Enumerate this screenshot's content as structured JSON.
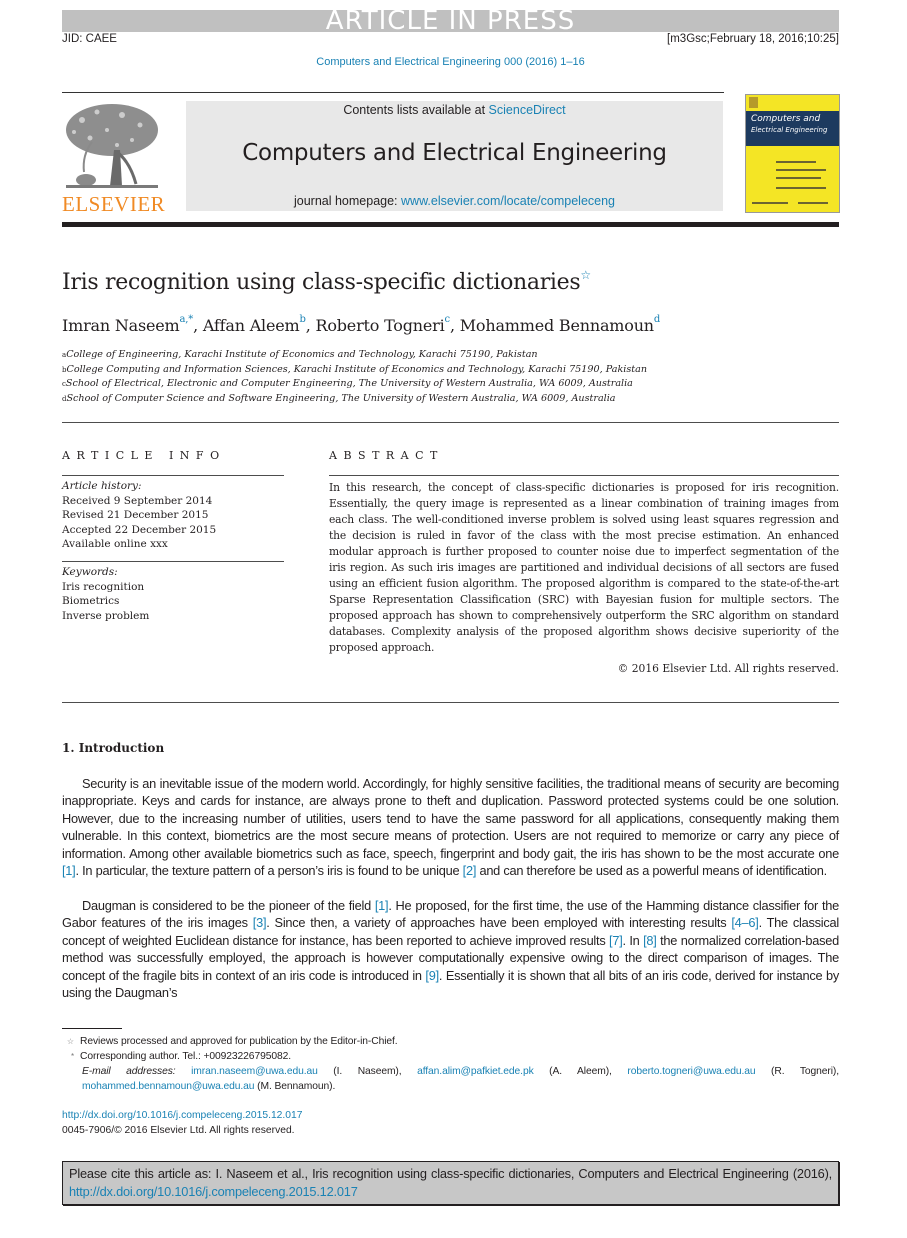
{
  "banner": {
    "press_label": "ARTICLE IN PRESS",
    "jid": "JID: CAEE",
    "stamp": "[m3Gsc;February 18, 2016;10:25]",
    "journal_ref": "Computers and Electrical Engineering 000 (2016) 1–16"
  },
  "header": {
    "publisher_logo_text": "ELSEVIER",
    "contents_prefix": "Contents lists available at ",
    "contents_link": "ScienceDirect",
    "journal_title": "Computers and Electrical Engineering",
    "homepage_prefix": "journal homepage: ",
    "homepage_link": "www.elsevier.com/locate/compeleceng",
    "cover_title_line1": "Computers and",
    "cover_title_line2": "Electrical Engineering"
  },
  "article": {
    "title": "Iris recognition using class-specific dictionaries",
    "title_mark": "☆",
    "authors": [
      {
        "name": "Imran Naseem",
        "sup": "a,*",
        "sep": ", "
      },
      {
        "name": "Affan Aleem",
        "sup": "b",
        "sep": ", "
      },
      {
        "name": "Roberto Togneri",
        "sup": "c",
        "sep": ", "
      },
      {
        "name": "Mohammed Bennamoun",
        "sup": "d",
        "sep": ""
      }
    ],
    "affiliations": [
      {
        "key": "a",
        "text": "College of Engineering, Karachi Institute of Economics and Technology, Karachi 75190, Pakistan"
      },
      {
        "key": "b",
        "text": "College Computing and Information Sciences, Karachi Institute of Economics and Technology, Karachi 75190, Pakistan"
      },
      {
        "key": "c",
        "text": "School of Electrical, Electronic and Computer Engineering, The University of Western Australia, WA 6009, Australia"
      },
      {
        "key": "d",
        "text": "School of Computer Science and Software Engineering, The University of Western Australia, WA 6009, Australia"
      }
    ]
  },
  "article_info": {
    "heading": "ARTICLE INFO",
    "history_label": "Article history:",
    "history": [
      "Received 9 September 2014",
      "Revised 21 December 2015",
      "Accepted 22 December 2015",
      "Available online xxx"
    ],
    "keywords_label": "Keywords:",
    "keywords": [
      "Iris recognition",
      "Biometrics",
      "Inverse problem"
    ]
  },
  "abstract": {
    "heading": "ABSTRACT",
    "text": "In this research, the concept of class-specific dictionaries is proposed for iris recognition. Essentially, the query image is represented as a linear combination of training images from each class. The well-conditioned inverse problem is solved using least squares regression and the decision is ruled in favor of the class with the most precise estimation. An enhanced modular approach is further proposed to counter noise due to imperfect segmentation of the iris region. As such iris images are partitioned and individual decisions of all sectors are fused using an efficient fusion algorithm. The proposed algorithm is compared to the state-of-the-art Sparse Representation Classification (SRC) with Bayesian fusion for multiple sectors. The proposed approach has shown to comprehensively outperform the SRC algorithm on standard databases. Complexity analysis of the proposed algorithm shows decisive superiority of the proposed approach.",
    "copyright": "© 2016 Elsevier Ltd. All rights reserved."
  },
  "introduction": {
    "heading": "1.  Introduction",
    "para1": [
      {
        "t": "Security is an inevitable issue of the modern world. Accordingly, for highly sensitive facilities, the traditional means of security are becoming inappropriate. Keys and cards for instance, are always prone to theft and duplication. Password protected systems could be one solution. However, due to the increasing number of utilities, users tend to have the same password for all applications, consequently making them vulnerable. In this context, biometrics are the most secure means of protection. Users are not required to memorize or carry any piece of information. Among other available biometrics such as face, speech, fingerprint and body gait, the iris has shown to be the most accurate one "
      },
      {
        "ref": "[1]"
      },
      {
        "t": ". In particular, the texture pattern of a person’s iris is found to be unique "
      },
      {
        "ref": "[2]"
      },
      {
        "t": " and can therefore be used as a powerful means of identification."
      }
    ],
    "para2": [
      {
        "t": "Daugman is considered to be the pioneer of the field "
      },
      {
        "ref": "[1]"
      },
      {
        "t": ". He proposed, for the first time, the use of the Hamming distance classifier for the Gabor features of the iris images "
      },
      {
        "ref": "[3]"
      },
      {
        "t": ". Since then, a variety of approaches have been employed with interesting results "
      },
      {
        "ref": "[4–6]"
      },
      {
        "t": ". The classical concept of weighted Euclidean distance for instance, has been reported to achieve improved results "
      },
      {
        "ref": "[7]"
      },
      {
        "t": ". In "
      },
      {
        "ref": "[8]"
      },
      {
        "t": " the normalized correlation-based method was successfully employed, the approach is however computationally expensive owing to the direct comparison of images. The concept of the fragile bits in context of an iris code is introduced in "
      },
      {
        "ref": "[9]"
      },
      {
        "t": ". Essentially it is shown that all bits of an iris code, derived for instance by using the Daugman’s"
      }
    ]
  },
  "footnotes": {
    "star_mark": "☆",
    "star_text": "Reviews processed and approved for publication by the Editor-in-Chief.",
    "corr_mark": "*",
    "corr_text": "Corresponding author. Tel.: +00923226795082.",
    "email_label": "E-mail addresses:",
    "emails": [
      {
        "addr": "imran.naseem@uwa.edu.au",
        "who": "(I. Naseem),"
      },
      {
        "addr": "affan.alim@pafkiet.ede.pk",
        "who": "(A. Aleem),"
      },
      {
        "addr": "roberto.togneri@uwa.edu.au",
        "who": "(R. Togneri),"
      },
      {
        "addr": "mohammed.bennamoun@uwa.edu.au",
        "who": "(M. Bennamoun)."
      }
    ],
    "doi": "http://dx.doi.org/10.1016/j.compeleceng.2015.12.017",
    "issn_line": "0045-7906/© 2016 Elsevier Ltd. All rights reserved."
  },
  "cite_box": {
    "prefix": "Please cite this article as: I. Naseem et al., Iris recognition using class-specific dictionaries, Computers and Electrical Engineering (2016), ",
    "doi": "http://dx.doi.org/10.1016/j.compeleceng.2015.12.017"
  },
  "colors": {
    "link": "#1a82b4",
    "elsevier_orange": "#f08a24",
    "banner_gray": "#c0c0c0",
    "cite_box_gray": "#c7c7c7",
    "cover_yellow": "#f4e525",
    "cover_navy": "#1d3a5f"
  }
}
